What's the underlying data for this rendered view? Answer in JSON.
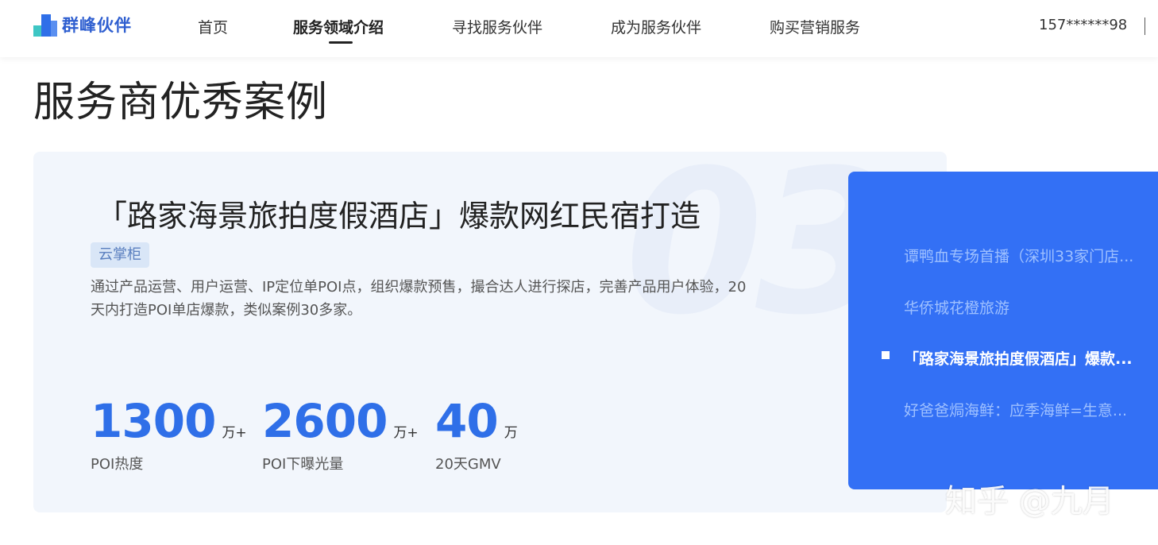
{
  "header": {
    "logo_text": "群峰伙伴",
    "nav": [
      {
        "label": "首页"
      },
      {
        "label": "服务领域介绍"
      },
      {
        "label": "寻找服务伙伴"
      },
      {
        "label": "成为服务伙伴"
      },
      {
        "label": "购买营销服务"
      }
    ],
    "active_nav": "服务领域介绍",
    "user_phone": "157******98"
  },
  "page_title": "服务商优秀案例",
  "case": {
    "index": "03",
    "title": "「路家海景旅拍度假酒店」爆款网红民宿打造",
    "tag": "云掌柜",
    "description": "通过产品运营、用户运营、IP定位单POI点，组织爆款预售，撮合达人进行探店，完善产品用户体验，20天内打造POI单店爆款，类似案例30多家。",
    "stats": [
      {
        "value": "1300",
        "unit": "万+",
        "label": "POI热度"
      },
      {
        "value": "2600",
        "unit": "万+",
        "label": "POI下曝光量"
      },
      {
        "value": "40",
        "unit": "万",
        "label": "20天GMV"
      }
    ]
  },
  "case_list": [
    {
      "label": "谭鸭血专场首播（深圳33家门店...",
      "active": false
    },
    {
      "label": "华侨城花橙旅游",
      "active": false
    },
    {
      "label": "「路家海景旅拍度假酒店」爆款...",
      "active": true
    },
    {
      "label": "好爸爸焗海鲜：应季海鲜=生意...",
      "active": false
    }
  ],
  "watermark": "知乎 @九月",
  "colors": {
    "brand_blue": "#2f6fe8",
    "panel_blue": "#3370f5",
    "card_bg": "#f2f6fc"
  }
}
